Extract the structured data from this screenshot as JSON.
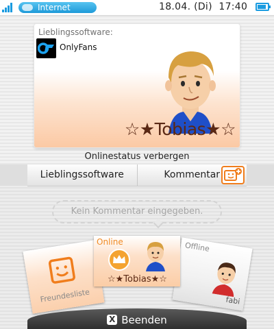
{
  "status_bar": {
    "connection_label": "Internet",
    "datetime": "18.04. (Di)  17:40",
    "wifi_bars": 4,
    "battery_level": 0.8,
    "accent_color": "#1a9be0"
  },
  "profile_card": {
    "favorite_label": "Lieblingssoftware:",
    "favorite_app_name": "OnlyFans",
    "favorite_app_icon": "onlyfans-logo-icon",
    "name": "☆★Tobias★☆",
    "background_color": "#fbc9a4"
  },
  "online_status_label": "Onlinestatus verbergen",
  "tabs": [
    {
      "label": "Lieblingssoftware"
    },
    {
      "label": "Kommentar"
    }
  ],
  "add_friend_icon": "add-friend-icon",
  "comment_placeholder": "Kein Kommentar eingegeben.",
  "friend_cards": {
    "friend_list": {
      "label": "Freundesliste",
      "icon": "smiley-square-icon"
    },
    "self": {
      "status": "Online",
      "name": "☆★Tobias★☆",
      "icon": "crown-icon"
    },
    "friend": {
      "status": "Offline",
      "name": "fabi"
    }
  },
  "end_button": {
    "icon": "x-button-icon",
    "glyph": "X",
    "label": "Beenden"
  }
}
